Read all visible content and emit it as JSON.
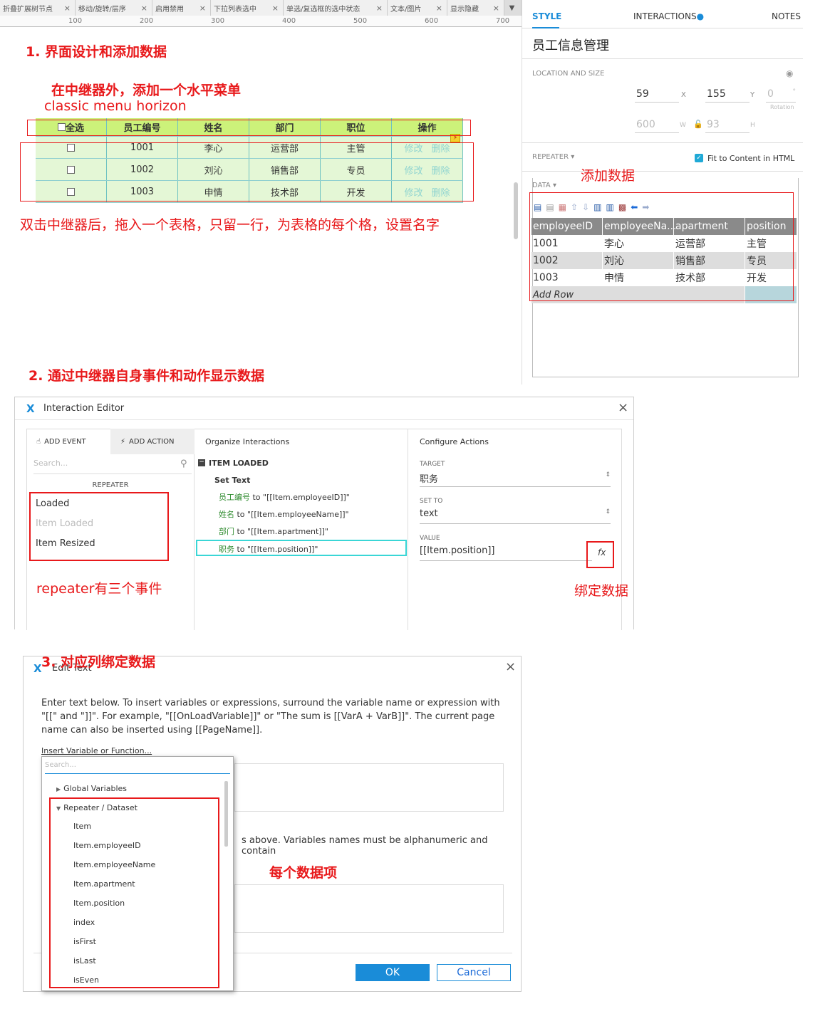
{
  "tabs": [
    "折叠扩展树节点",
    "移动/旋转/层序",
    "启用禁用",
    "下拉列表选中",
    "单选/复选框的选中状态",
    "文本/图片",
    "显示隐藏"
  ],
  "ruler": [
    "100",
    "200",
    "300",
    "400",
    "500",
    "600",
    "700"
  ],
  "annotations": {
    "step1": "1. 界面设计和添加数据",
    "menu_note": "在中继器外，添加一个水平菜单",
    "menu_name": "classic menu horizon",
    "table_note": "双击中继器后，拖入一个表格，只留一行，为表格的每个格，设置名字",
    "add_data": "添加数据",
    "step2": "2. 通过中继器自身事件和动作显示数据",
    "events_note": "repeater有三个事件",
    "bind_note": "绑定数据",
    "step3": "3. 对应列绑定数据",
    "items_note": "每个数据项"
  },
  "mock_table": {
    "headers": [
      "全选",
      "员工编号",
      "姓名",
      "部门",
      "职位",
      "操作"
    ],
    "rows": [
      {
        "id": "1001",
        "name": "李心",
        "dept": "运营部",
        "pos": "主管"
      },
      {
        "id": "1002",
        "name": "刘沁",
        "dept": "销售部",
        "pos": "专员"
      },
      {
        "id": "1003",
        "name": "申情",
        "dept": "技术部",
        "pos": "开发"
      }
    ],
    "edit": "修改",
    "delete": "删除"
  },
  "panel": {
    "tabs": {
      "style": "STYLE",
      "interactions": "INTERACTIONS",
      "notes": "NOTES"
    },
    "title": "员工信息管理",
    "loc_label": "LOCATION AND SIZE",
    "x": "59",
    "x_label": "X",
    "y": "155",
    "y_label": "Y",
    "rot": "0",
    "rot_unit": "°",
    "rot_label": "Rotation",
    "w": "600",
    "w_label": "W",
    "h": "93",
    "h_label": "H",
    "repeater_label": "REPEATER ▾",
    "fit": "Fit to Content in HTML",
    "data_label": "DATA ▾",
    "grid_headers": [
      "employeeID",
      "employeeNa...",
      "apartment",
      "position"
    ],
    "grid_rows": [
      [
        "1001",
        "李心",
        "运营部",
        "主管"
      ],
      [
        "1002",
        "刘沁",
        "销售部",
        "专员"
      ],
      [
        "1003",
        "申情",
        "技术部",
        "开发"
      ]
    ],
    "add_row": "Add Row"
  },
  "interaction_editor": {
    "title": "Interaction Editor",
    "add_event": "ADD EVENT",
    "add_action": "ADD ACTION",
    "search": "Search...",
    "section": "REPEATER",
    "events": [
      "Loaded",
      "Item Loaded",
      "Item Resized"
    ],
    "organize": "Organize Interactions",
    "item_loaded": "ITEM LOADED",
    "set_text": "Set Text",
    "actions": [
      {
        "target": "员工编号",
        "value": " to \"[[Item.employeeID]]\""
      },
      {
        "target": "姓名",
        "value": " to \"[[Item.employeeName]]\""
      },
      {
        "target": "部门",
        "value": " to \"[[Item.apartment]]\""
      },
      {
        "target": "职务",
        "value": " to \"[[Item.position]]\""
      }
    ],
    "configure": "Configure Actions",
    "target_label": "TARGET",
    "target_val": "职务",
    "setto_label": "SET TO",
    "setto_val": "text",
    "value_label": "VALUE",
    "value_val": "[[Item.position]]",
    "fx": "fx"
  },
  "edit_text": {
    "title": "Edit Text",
    "instructions": "Enter text below. To insert variables or expressions, surround the variable name or expression with \"[[\" and \"]]\". For example, \"[[OnLoadVariable]]\" or \"The sum is [[VarA + VarB]]\". The current page name can also be inserted using [[PageName]].",
    "insert_link": "Insert Variable or Function...",
    "search": "Search...",
    "global": "Global Variables",
    "repeater_group": "Repeater / Dataset",
    "vars": [
      "Item",
      "Item.employeeID",
      "Item.employeeName",
      "Item.apartment",
      "Item.position",
      "index",
      "isFirst",
      "isLast",
      "isEven"
    ],
    "partial_text": "s above. Variables names must be alphanumeric and contain",
    "ok": "OK",
    "cancel": "Cancel"
  }
}
